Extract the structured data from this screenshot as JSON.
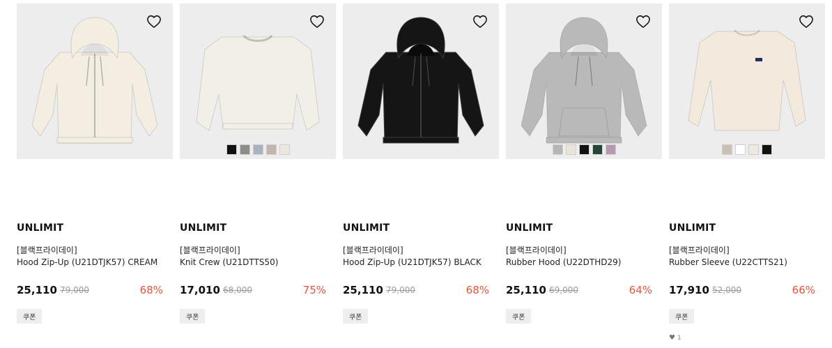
{
  "products": [
    {
      "brand": "UNLIMIT",
      "tag": "[블랙프라이데이]",
      "name": "Hood Zip-Up (U21DTJK57) CREAM",
      "price": "25,110",
      "original_price": "79,000",
      "discount": "68%",
      "coupon": "쿠폰",
      "garment": "zip-hoodie",
      "garment_color": "#f3ede2",
      "swatches": []
    },
    {
      "brand": "UNLIMIT",
      "tag": "[블랙프라이데이]",
      "name": "Knit Crew (U21DTTS50)",
      "price": "17,010",
      "original_price": "68,000",
      "discount": "75%",
      "coupon": "쿠폰",
      "garment": "crew-sweater",
      "garment_color": "#f2efe6",
      "swatches": [
        "#111111",
        "#8e8d88",
        "#a8b3c0",
        "#c2b5ae",
        "#ece8dc"
      ]
    },
    {
      "brand": "UNLIMIT",
      "tag": "[블랙프라이데이]",
      "name": "Hood Zip-Up (U21DTJK57) BLACK",
      "price": "25,110",
      "original_price": "79,000",
      "discount": "68%",
      "coupon": "쿠폰",
      "garment": "zip-hoodie",
      "garment_color": "#151515",
      "swatches": []
    },
    {
      "brand": "UNLIMIT",
      "tag": "[블랙프라이데이]",
      "name": "Rubber Hood (U22DTHD29)",
      "price": "25,110",
      "original_price": "69,000",
      "discount": "64%",
      "coupon": "쿠폰",
      "garment": "pullover-hoodie",
      "garment_color": "#b9b9b9",
      "swatches": [
        "#b8b6b4",
        "#e9e3d8",
        "#121212",
        "#23453a",
        "#b59aae"
      ]
    },
    {
      "brand": "UNLIMIT",
      "tag": "[블랙프라이데이]",
      "name": "Rubber Sleeve (U22CTTS21)",
      "price": "17,910",
      "original_price": "52,000",
      "discount": "66%",
      "coupon": "쿠폰",
      "garment": "long-sleeve-tee",
      "garment_color": "#f3e9dc",
      "swatches": [
        "#c9c0b6",
        "#ffffff",
        "#eee8de",
        "#111111"
      ],
      "likes": "1"
    }
  ],
  "colors": {
    "discount": "#e8553a",
    "thumb_bg": "#ededed",
    "coupon_bg": "#eeeeee"
  }
}
